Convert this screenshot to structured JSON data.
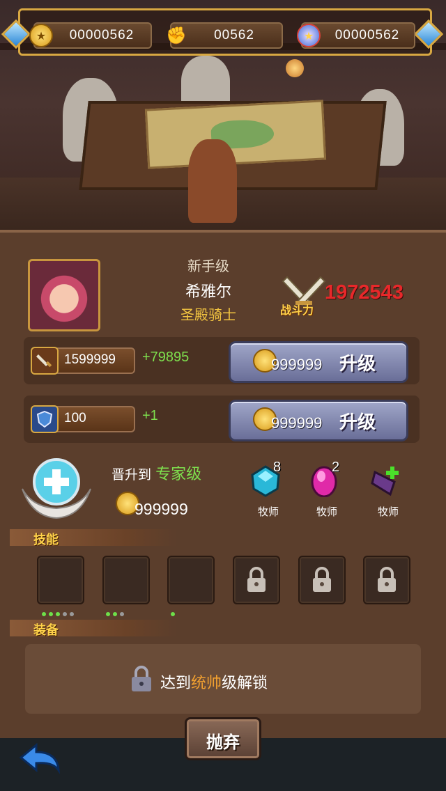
{
  "resources": {
    "gold": "00000562",
    "power": "00562",
    "gems": "00000562"
  },
  "hero": {
    "grade": "新手级",
    "name": "希雅尔",
    "class": "圣殿骑士",
    "power_label": "战斗力",
    "power_value": "1972543"
  },
  "stats": [
    {
      "icon": "sword-icon",
      "value": "1599999",
      "plus": "+79895",
      "cost": "999999",
      "button": "升级"
    },
    {
      "icon": "shield-icon",
      "value": "100",
      "plus": "+1",
      "cost": "999999",
      "button": "升级"
    }
  ],
  "promote": {
    "prefix": "晋升到",
    "target": "专家级",
    "cost": "999999"
  },
  "materials": [
    {
      "icon": "blue-gem-icon",
      "count": "8",
      "label": "牧师",
      "color": "#2ab8d8"
    },
    {
      "icon": "pink-gem-icon",
      "count": "2",
      "label": "牧师",
      "color": "#e02aa8"
    },
    {
      "icon": "purple-crystal-icon",
      "count": "",
      "label": "牧师",
      "color": "#6a3a8a"
    }
  ],
  "sections": {
    "skills": "技能",
    "equipment": "装备"
  },
  "skill_slots": [
    {
      "locked": false,
      "dots": [
        1,
        1,
        1,
        0,
        0
      ]
    },
    {
      "locked": false,
      "dots": [
        1,
        1,
        0
      ]
    },
    {
      "locked": false,
      "dots": [
        1
      ]
    },
    {
      "locked": true
    },
    {
      "locked": true
    },
    {
      "locked": true
    }
  ],
  "equipment": {
    "msg_a": "达到",
    "msg_hl": "统帅",
    "msg_b": "级解锁"
  },
  "buttons": {
    "discard": "抛弃"
  },
  "colors": {
    "accent_green": "#7ee04e",
    "power_red": "#e8282a",
    "gold": "#f2c440"
  }
}
